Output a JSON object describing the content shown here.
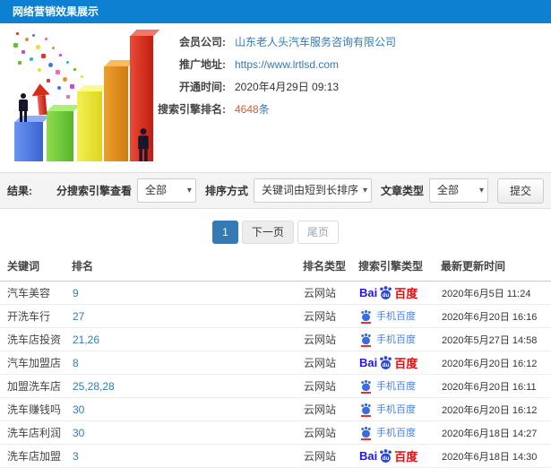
{
  "header": {
    "title": "网络营销效果展示"
  },
  "info": {
    "rows": [
      {
        "label": "会员公司:",
        "value": "山东老人头汽车服务咨询有限公司"
      },
      {
        "label": "推广地址:",
        "value": "https://www.lrtlsd.com"
      },
      {
        "label": "开通时间:",
        "value": "2020年4月29日 09:13"
      },
      {
        "label": "搜索引擎排名:",
        "count": "4648",
        "unit": "条"
      }
    ]
  },
  "filters": {
    "result_label": "结果:",
    "engine_filter_label": "分搜索引擎查看",
    "engine_filter_value": "全部",
    "sort_label": "排序方式",
    "sort_value": "关键词由短到长排序",
    "article_type_label": "文章类型",
    "article_type_value": "全部",
    "submit_label": "提交"
  },
  "pagination": {
    "current": "1",
    "next": "下一页",
    "last": "尾页"
  },
  "table": {
    "columns": [
      "关键词",
      "排名",
      "排名类型",
      "搜索引擎类型",
      "最新更新时间"
    ],
    "engine_logo": {
      "bai": "Bai",
      "du": "du",
      "baidu": "百度",
      "mobile": "手机百度"
    },
    "rows": [
      {
        "keyword": "汽车美容",
        "rank": "9",
        "rank_type": "云网站",
        "engine": "baidu",
        "updated": "2020年6月5日 11:24"
      },
      {
        "keyword": "开洗车行",
        "rank": "27",
        "rank_type": "云网站",
        "engine": "baidu-mobile",
        "updated": "2020年6月20日 16:16"
      },
      {
        "keyword": "洗车店投资",
        "rank": "21,26",
        "rank_type": "云网站",
        "engine": "baidu-mobile",
        "updated": "2020年5月27日 14:58"
      },
      {
        "keyword": "汽车加盟店",
        "rank": "8",
        "rank_type": "云网站",
        "engine": "baidu",
        "updated": "2020年6月20日 16:12"
      },
      {
        "keyword": "加盟洗车店",
        "rank": "25,28,28",
        "rank_type": "云网站",
        "engine": "baidu-mobile",
        "updated": "2020年6月20日 16:11"
      },
      {
        "keyword": "洗车赚钱吗",
        "rank": "30",
        "rank_type": "云网站",
        "engine": "baidu-mobile",
        "updated": "2020年6月20日 16:12"
      },
      {
        "keyword": "洗车店利润",
        "rank": "30",
        "rank_type": "云网站",
        "engine": "baidu-mobile",
        "updated": "2020年6月18日 14:27"
      },
      {
        "keyword": "洗车店加盟",
        "rank": "3",
        "rank_type": "云网站",
        "engine": "baidu",
        "updated": "2020年6月18日 14:30"
      }
    ]
  },
  "colors": {
    "header_bg": "#0d80d2",
    "link_blue": "#337ab7",
    "count_orange": "#e4572e",
    "baidu_blue": "#2319dc",
    "baidu_red": "#e10b12",
    "mobile_blue": "#4a7fe8",
    "pagination_active": "#337ab7"
  }
}
